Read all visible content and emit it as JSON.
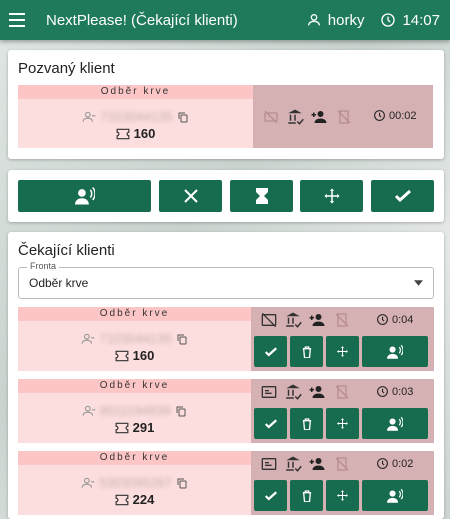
{
  "appbar": {
    "title": "NextPlease! (Čekající klienti)",
    "user": "horky",
    "time": "14:07"
  },
  "invited": {
    "title": "Pozvaný klient",
    "service": "Odběr krve",
    "client_id": "7103044135",
    "ticket": "160",
    "elapsed": "00:02"
  },
  "waiting": {
    "title": "Čekající klienti",
    "queue_label": "Fronta",
    "queue_value": "Odběr krve",
    "clients": [
      {
        "service": "Odběr krve",
        "client_id": "7103044135",
        "ticket": "160",
        "elapsed": "0:04"
      },
      {
        "service": "Odběr krve",
        "client_id": "8011194839",
        "ticket": "291",
        "elapsed": "0:03"
      },
      {
        "service": "Odběr krve",
        "client_id": "5303095267",
        "ticket": "224",
        "elapsed": "0:02"
      }
    ]
  },
  "colors": {
    "appbar": "#1f7a5c",
    "button": "#176b4e",
    "ticket_bg": "#fddede",
    "ticket_head": "#fcc6c6",
    "panel": "#d6b1b4"
  }
}
